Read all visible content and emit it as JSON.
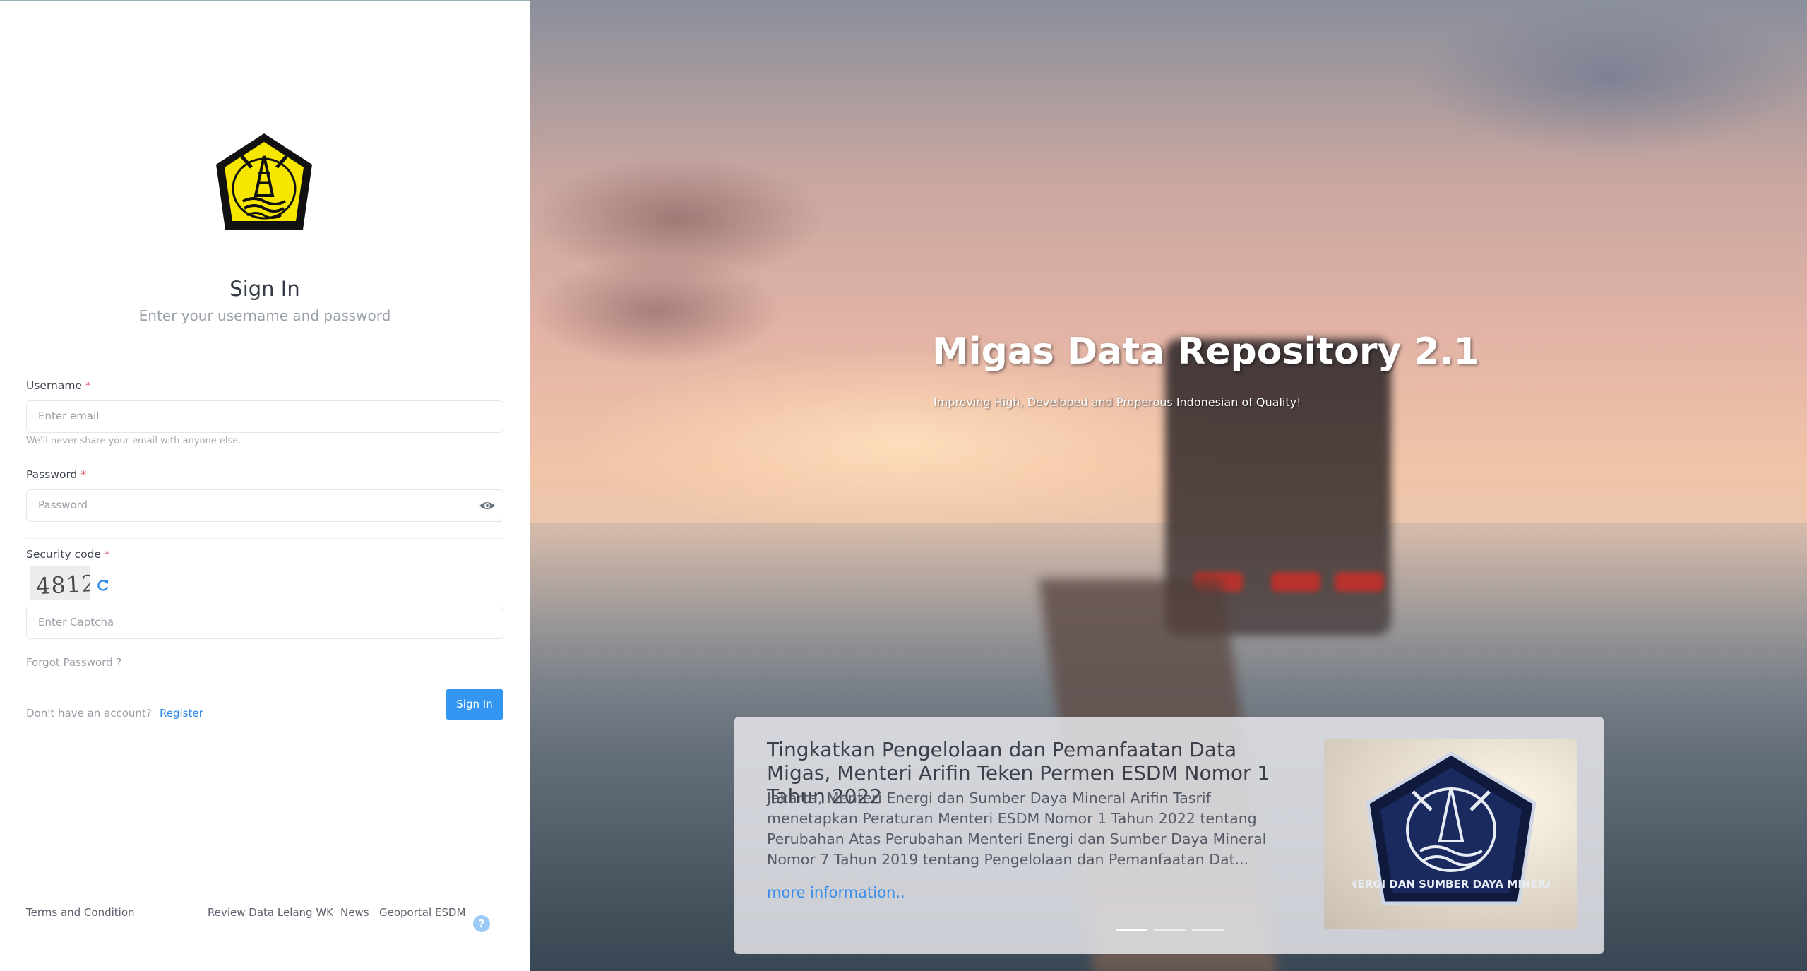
{
  "brand": {
    "logo_icon": "esdm-emblem-icon",
    "logo_text": "ENERGI DAN SUMBER DAYA MINERAL"
  },
  "signin": {
    "title": "Sign In",
    "subtitle": "Enter your username and password"
  },
  "form": {
    "username_label": "Username",
    "required_mark": "*",
    "username_placeholder": "Enter email",
    "username_help": "We'll never share your email with anyone else.",
    "password_label": "Password",
    "password_placeholder": "Password",
    "security_label": "Security code",
    "captcha_value": "4812",
    "captcha_placeholder": "Enter Captcha",
    "forgot_link": "Forgot Password ?",
    "no_account_text": "Don't have an account?",
    "register_link": "Register",
    "signin_button": "Sign In"
  },
  "footer": {
    "terms": "Terms and Condition",
    "links": [
      "Review Data Lelang WK",
      "News",
      "Geoportal ESDM"
    ],
    "help_icon": "?"
  },
  "hero": {
    "title": "Migas Data Repository 2.1",
    "subtitle": "Improving High, Developed and Properous Indonesian of Quality!"
  },
  "news": {
    "title": "Tingkatkan Pengelolaan dan Pemanfaatan Data Migas, Menteri Arifin Teken Permen ESDM Nomor 1 Tahun 2022",
    "body": "Jakarta, Menteri Energi dan Sumber Daya Mineral Arifin Tasrif menetapkan Peraturan Menteri ESDM Nomor 1 Tahun 2022 tentang Perubahan Atas Perubahan Menteri Energi dan Sumber Daya Mineral Nomor 7 Tahun 2019 tentang Pengelolaan dan Pemanfaatan Dat...",
    "link": "more information..",
    "slide_count": 3,
    "active_slide": 1
  },
  "colors": {
    "primary": "#3296f2",
    "link": "#2e8ae6",
    "required": "#e0435c",
    "logo_yellow": "#f7e600",
    "logo_black": "#111111"
  }
}
